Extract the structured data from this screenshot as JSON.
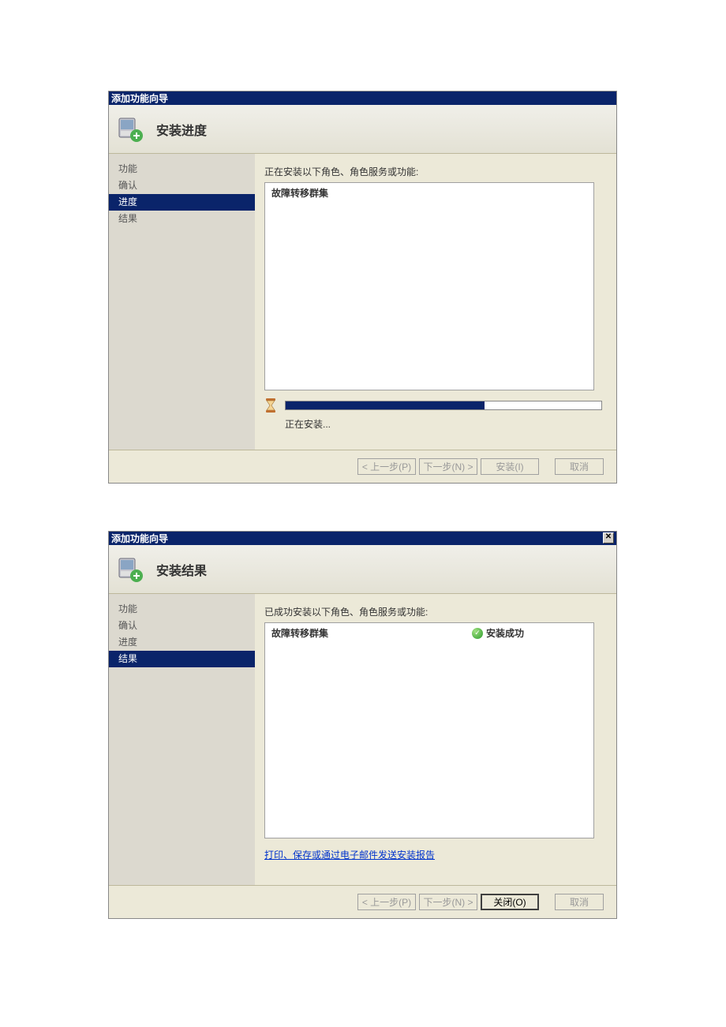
{
  "dialog1": {
    "title": "添加功能向导",
    "header_title": "安装进度",
    "sidebar": {
      "items": [
        {
          "label": "功能"
        },
        {
          "label": "确认"
        },
        {
          "label": "进度"
        },
        {
          "label": "结果"
        }
      ],
      "selected_index": 2
    },
    "content": {
      "prompt": "正在安装以下角色、角色服务或功能:",
      "feature_name": "故障转移群集",
      "progress_text": "正在安装...",
      "progress_percent": 63
    },
    "footer": {
      "prev": "< 上一步(P)",
      "next": "下一步(N) >",
      "install": "安装(I)",
      "cancel": "取消"
    }
  },
  "dialog2": {
    "title": "添加功能向导",
    "header_title": "安装结果",
    "sidebar": {
      "items": [
        {
          "label": "功能"
        },
        {
          "label": "确认"
        },
        {
          "label": "进度"
        },
        {
          "label": "结果"
        }
      ],
      "selected_index": 3
    },
    "content": {
      "prompt": "已成功安装以下角色、角色服务或功能:",
      "feature_name": "故障转移群集",
      "status_text": "安装成功",
      "report_link": "打印、保存或通过电子邮件发送安装报告"
    },
    "footer": {
      "prev": "< 上一步(P)",
      "next": "下一步(N) >",
      "close": "关闭(O)",
      "cancel": "取消"
    }
  }
}
